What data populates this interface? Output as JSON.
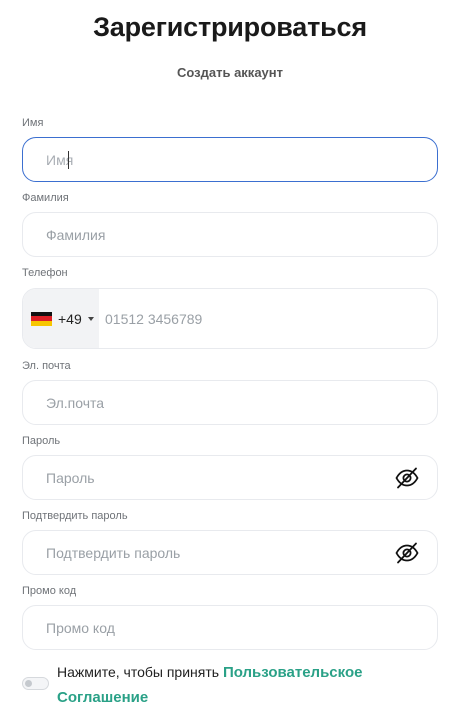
{
  "header": {
    "title": "Зарегистрироваться",
    "subtitle": "Создать аккаунт"
  },
  "form": {
    "first_name": {
      "label": "Имя",
      "placeholder": "Имя",
      "value": ""
    },
    "last_name": {
      "label": "Фамилия",
      "placeholder": "Фамилия",
      "value": ""
    },
    "phone": {
      "label": "Телефон",
      "country_flag": "germany-flag",
      "dial_code": "+49",
      "placeholder": "01512 3456789",
      "value": ""
    },
    "email": {
      "label": "Эл. почта",
      "placeholder": "Эл.почта",
      "value": ""
    },
    "password": {
      "label": "Пароль",
      "placeholder": "Пароль",
      "value": "",
      "toggle_icon": "eye-off-icon"
    },
    "confirm_password": {
      "label": "Подтвердить пароль",
      "placeholder": "Подтвердить пароль",
      "value": "",
      "toggle_icon": "eye-off-icon"
    },
    "promo": {
      "label": "Промо код",
      "placeholder": "Промо код",
      "value": ""
    }
  },
  "terms": {
    "prefix": "Нажмите, чтобы принять",
    "link": "Пользовательское Соглашение",
    "accepted": false
  },
  "colors": {
    "accent_link": "#2aa187",
    "focus_border": "#3b6fd0",
    "field_border": "#e8eaee"
  }
}
